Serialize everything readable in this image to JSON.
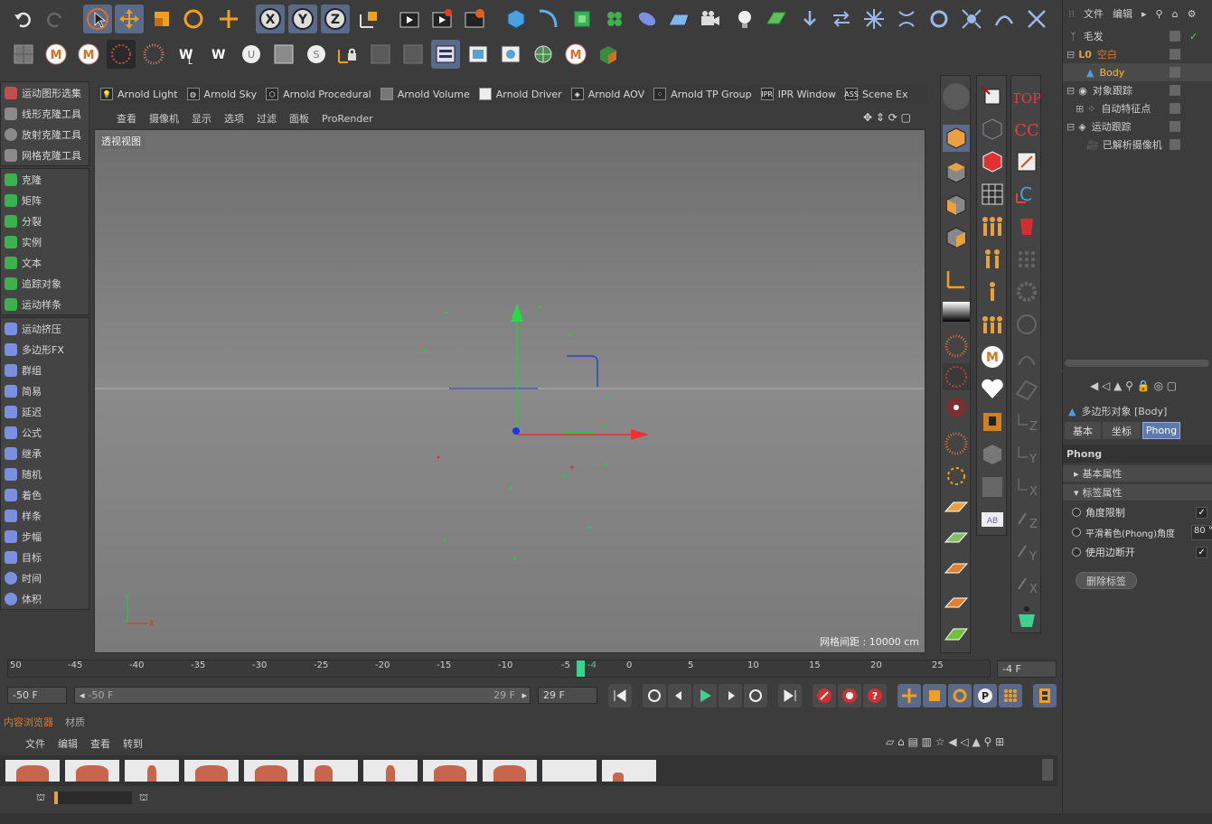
{
  "plugins": [
    {
      "label": "Arnold Light",
      "icon": "bulb-icon"
    },
    {
      "label": "Arnold Sky",
      "icon": "sky-icon"
    },
    {
      "label": "Arnold Procedural",
      "icon": "procedural-icon"
    },
    {
      "label": "Arnold Volume",
      "icon": "volume-icon"
    },
    {
      "label": "Arnold Driver",
      "icon": "driver-icon"
    },
    {
      "label": "Arnold AOV",
      "icon": "aov-icon"
    },
    {
      "label": "Arnold TP Group",
      "icon": "tp-group-icon"
    },
    {
      "label": "IPR Window",
      "icon": "ipr-icon"
    },
    {
      "label": "Scene Ex",
      "icon": "scene-export-icon"
    }
  ],
  "ipr_badge": "IPR",
  "ass_badge": "ASS",
  "viewport_menu": [
    "查看",
    "摄像机",
    "显示",
    "选项",
    "过滤",
    "面板",
    "ProRender"
  ],
  "viewport_label": "透视视图",
  "grid_spacing": "网格间距 : 10000 cm",
  "left_tools": {
    "clone_tools": [
      "运动图形选集",
      "线形克隆工具",
      "放射克隆工具",
      "网格克隆工具"
    ],
    "generators": [
      "克隆",
      "矩阵",
      "分裂",
      "实例",
      "文本",
      "追踪对象",
      "运动样条"
    ],
    "effectors": [
      "运动挤压",
      "多边形FX",
      "群组",
      "简易",
      "延迟",
      "公式",
      "继承",
      "随机",
      "着色",
      "样条",
      "步幅",
      "目标",
      "时间",
      "体积"
    ]
  },
  "object_manager": {
    "menu": [
      "文件",
      "编辑"
    ],
    "objects": [
      {
        "name": "毛发",
        "color": "#dddddd"
      },
      {
        "name": "空白",
        "color": "#e2761e"
      },
      {
        "name": "Body",
        "color": "#f0c040"
      },
      {
        "name": "对象跟踪",
        "color": "#dddddd"
      },
      {
        "name": "自动特征点",
        "color": "#dddddd"
      },
      {
        "name": "运动跟踪",
        "color": "#dddddd"
      },
      {
        "name": "已解析摄像机",
        "color": "#dddddd"
      }
    ]
  },
  "attributes": {
    "title": "多边形对象 [Body]",
    "tabs": [
      "基本",
      "坐标",
      "Phong"
    ],
    "section": "Phong",
    "groups": [
      "基本属性",
      "标签属性"
    ],
    "props": [
      {
        "label": "角度限制",
        "value": "✓"
      },
      {
        "label": "平滑着色(Phong)角度",
        "value": "80 °"
      },
      {
        "label": "使用边断开",
        "value": "✓"
      }
    ],
    "delete_tag": "删除标签"
  },
  "timeline": {
    "ticks": [
      "50",
      "-45",
      "-40",
      "-35",
      "-30",
      "-25",
      "-20",
      "-15",
      "-10",
      "-5",
      "-4",
      "0",
      "5",
      "10",
      "15",
      "20",
      "25"
    ],
    "current_frame": "-4 F",
    "start_field": "-50 F",
    "range_start": "-50 F",
    "range_end": "29 F",
    "end_field": "29 F"
  },
  "content_browser": {
    "tabs": [
      "内容浏览器",
      "材质"
    ],
    "menu": [
      "文件",
      "编辑",
      "查看",
      "转到"
    ],
    "thumb_count": 11
  }
}
